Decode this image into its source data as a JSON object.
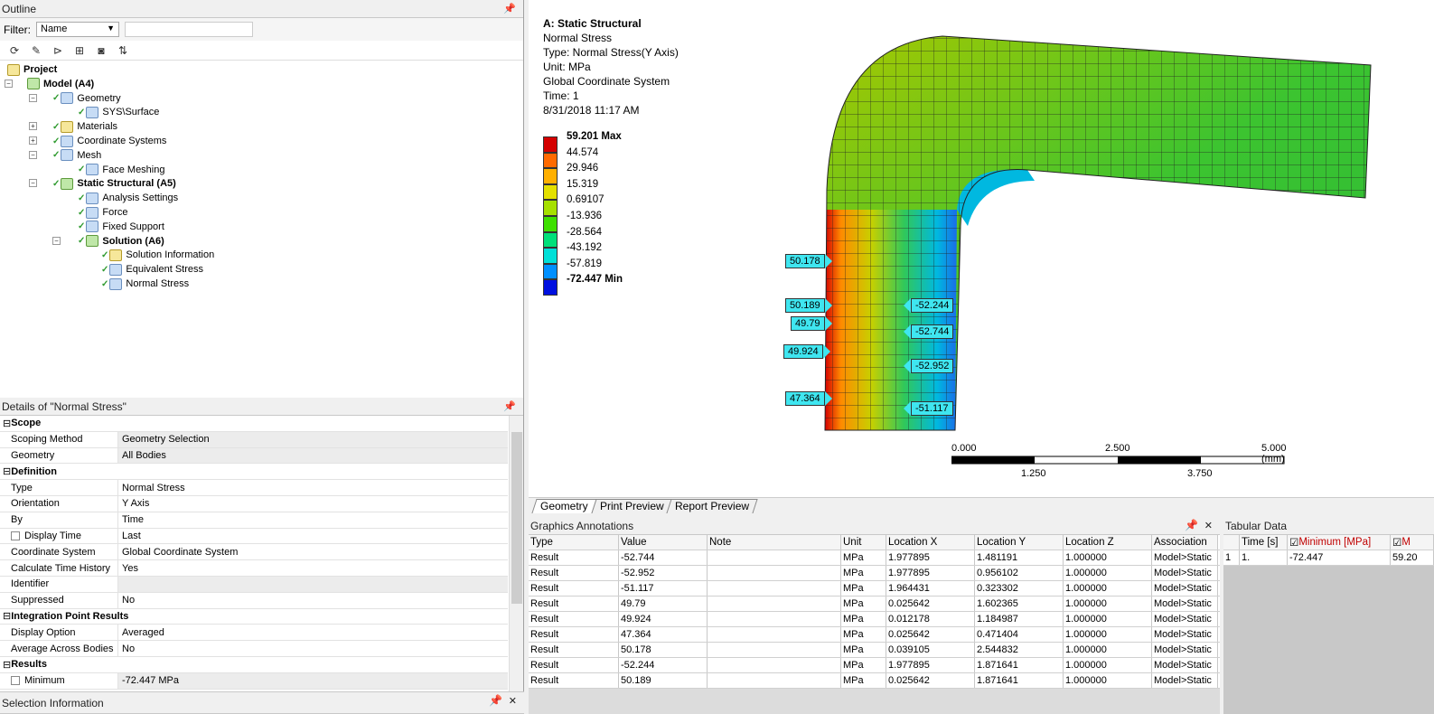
{
  "outline": {
    "title": "Outline",
    "filter_label": "Filter:",
    "filter_value": "Name",
    "tree": [
      {
        "label": "Project",
        "bold": true
      },
      {
        "label": "Model (A4)",
        "bold": true
      },
      {
        "label": "Geometry"
      },
      {
        "label": "SYS\\Surface"
      },
      {
        "label": "Materials"
      },
      {
        "label": "Coordinate Systems"
      },
      {
        "label": "Mesh"
      },
      {
        "label": "Face Meshing"
      },
      {
        "label": "Static Structural (A5)",
        "bold": true
      },
      {
        "label": "Analysis Settings"
      },
      {
        "label": "Force"
      },
      {
        "label": "Fixed Support"
      },
      {
        "label": "Solution (A6)",
        "bold": true
      },
      {
        "label": "Solution Information"
      },
      {
        "label": "Equivalent Stress"
      },
      {
        "label": "Normal Stress"
      }
    ]
  },
  "details": {
    "title": "Details of \"Normal Stress\"",
    "rows": [
      {
        "section": "Scope"
      },
      {
        "k": "Scoping Method",
        "v": "Geometry Selection",
        "grey": true
      },
      {
        "k": "Geometry",
        "v": "All Bodies",
        "grey": true
      },
      {
        "section": "Definition"
      },
      {
        "k": "Type",
        "v": "Normal Stress"
      },
      {
        "k": "Orientation",
        "v": "Y Axis"
      },
      {
        "k": "By",
        "v": "Time"
      },
      {
        "k": "Display Time",
        "v": "Last",
        "check": true
      },
      {
        "k": "Coordinate System",
        "v": "Global Coordinate System"
      },
      {
        "k": "Calculate Time History",
        "v": "Yes"
      },
      {
        "k": "Identifier",
        "v": "",
        "grey": true
      },
      {
        "k": "Suppressed",
        "v": "No"
      },
      {
        "section": "Integration Point Results"
      },
      {
        "k": "Display Option",
        "v": "Averaged"
      },
      {
        "k": "Average Across Bodies",
        "v": "No"
      },
      {
        "section": "Results"
      },
      {
        "k": "Minimum",
        "v": "-72.447 MPa",
        "check": true,
        "grey": true
      }
    ]
  },
  "selection_info": {
    "title": "Selection Information"
  },
  "viewport": {
    "info": [
      "A: Static Structural",
      "Normal Stress",
      "Type: Normal Stress(Y Axis)",
      "Unit: MPa",
      "Global Coordinate System",
      "Time: 1",
      "8/31/2018 11:17 AM"
    ],
    "legend": {
      "labels": [
        "59.201 Max",
        "44.574",
        "29.946",
        "15.319",
        "0.69107",
        "-13.936",
        "-28.564",
        "-43.192",
        "-57.819",
        "-72.447 Min"
      ],
      "colors": [
        "#d40000",
        "#ff6a00",
        "#ffb000",
        "#e4e000",
        "#a6e000",
        "#3ee000",
        "#00e07a",
        "#00e0d8",
        "#0090ff",
        "#0010e0"
      ]
    },
    "probes": [
      {
        "v": "50.178",
        "side": "r"
      },
      {
        "v": "50.189",
        "side": "r"
      },
      {
        "v": "49.79",
        "side": "r"
      },
      {
        "v": "49.924",
        "side": "r"
      },
      {
        "v": "47.364",
        "side": "r"
      },
      {
        "v": "-52.244",
        "side": "l"
      },
      {
        "v": "-52.744",
        "side": "l"
      },
      {
        "v": "-52.952",
        "side": "l"
      },
      {
        "v": "-51.117",
        "side": "l"
      }
    ],
    "scale": {
      "top": [
        "0.000",
        "2.500",
        "5.000 (mm)"
      ],
      "bottom": [
        "1.250",
        "3.750"
      ]
    },
    "tabs": [
      "Geometry",
      "Print Preview",
      "Report Preview"
    ]
  },
  "graphics_annotations": {
    "title": "Graphics Annotations",
    "columns": [
      "Type",
      "Value",
      "Note",
      "Unit",
      "Location X",
      "Location Y",
      "Location Z",
      "Association"
    ],
    "rows": [
      [
        "Result",
        "-52.744",
        "",
        "MPa",
        "1.977895",
        "1.481191",
        "1.000000",
        "Model>Static"
      ],
      [
        "Result",
        "-52.952",
        "",
        "MPa",
        "1.977895",
        "0.956102",
        "1.000000",
        "Model>Static"
      ],
      [
        "Result",
        "-51.117",
        "",
        "MPa",
        "1.964431",
        "0.323302",
        "1.000000",
        "Model>Static"
      ],
      [
        "Result",
        "49.79",
        "",
        "MPa",
        "0.025642",
        "1.602365",
        "1.000000",
        "Model>Static"
      ],
      [
        "Result",
        "49.924",
        "",
        "MPa",
        "0.012178",
        "1.184987",
        "1.000000",
        "Model>Static"
      ],
      [
        "Result",
        "47.364",
        "",
        "MPa",
        "0.025642",
        "0.471404",
        "1.000000",
        "Model>Static"
      ],
      [
        "Result",
        "50.178",
        "",
        "MPa",
        "0.039105",
        "2.544832",
        "1.000000",
        "Model>Static"
      ],
      [
        "Result",
        "-52.244",
        "",
        "MPa",
        "1.977895",
        "1.871641",
        "1.000000",
        "Model>Static"
      ],
      [
        "Result",
        "50.189",
        "",
        "MPa",
        "0.025642",
        "1.871641",
        "1.000000",
        "Model>Static"
      ]
    ]
  },
  "tabular": {
    "title": "Tabular Data",
    "columns": [
      "Time [s]",
      "Minimum [MPa]",
      "M"
    ],
    "rows": [
      [
        "1",
        "1.",
        "-72.447",
        "59.20"
      ]
    ]
  }
}
